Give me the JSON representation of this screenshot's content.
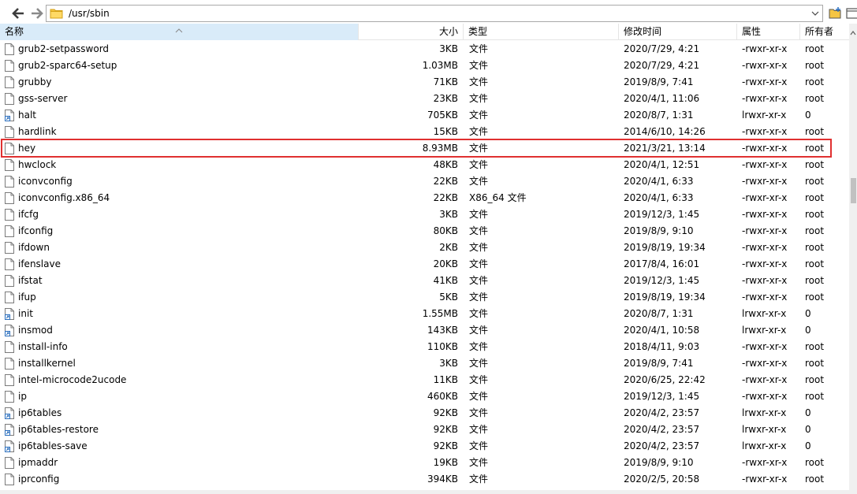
{
  "toolbar": {
    "back_icon": "arrow-left-icon",
    "forward_icon": "arrow-right-icon",
    "path": "/usr/sbin"
  },
  "columns": {
    "name": "名称",
    "size": "大小",
    "type": "类型",
    "mtime": "修改时间",
    "attr": "属性",
    "owner": "所有者"
  },
  "files": [
    {
      "name": "grub2-setpassword",
      "size": "3KB",
      "type": "文件",
      "mtime": "2020/7/29, 4:21",
      "attr": "-rwxr-xr-x",
      "owner": "root",
      "link": false
    },
    {
      "name": "grub2-sparc64-setup",
      "size": "1.03MB",
      "type": "文件",
      "mtime": "2020/7/29, 4:21",
      "attr": "-rwxr-xr-x",
      "owner": "root",
      "link": false
    },
    {
      "name": "grubby",
      "size": "71KB",
      "type": "文件",
      "mtime": "2019/8/9, 7:41",
      "attr": "-rwxr-xr-x",
      "owner": "root",
      "link": false
    },
    {
      "name": "gss-server",
      "size": "23KB",
      "type": "文件",
      "mtime": "2020/4/1, 11:06",
      "attr": "-rwxr-xr-x",
      "owner": "root",
      "link": false
    },
    {
      "name": "halt",
      "size": "705KB",
      "type": "文件",
      "mtime": "2020/8/7, 1:31",
      "attr": "lrwxr-xr-x",
      "owner": "0",
      "link": true
    },
    {
      "name": "hardlink",
      "size": "15KB",
      "type": "文件",
      "mtime": "2014/6/10, 14:26",
      "attr": "-rwxr-xr-x",
      "owner": "root",
      "link": false
    },
    {
      "name": "hey",
      "size": "8.93MB",
      "type": "文件",
      "mtime": "2021/3/21, 13:14",
      "attr": "-rwxr-xr-x",
      "owner": "root",
      "link": false
    },
    {
      "name": "hwclock",
      "size": "48KB",
      "type": "文件",
      "mtime": "2020/4/1, 12:51",
      "attr": "-rwxr-xr-x",
      "owner": "root",
      "link": false
    },
    {
      "name": "iconvconfig",
      "size": "22KB",
      "type": "文件",
      "mtime": "2020/4/1, 6:33",
      "attr": "-rwxr-xr-x",
      "owner": "root",
      "link": false
    },
    {
      "name": "iconvconfig.x86_64",
      "size": "22KB",
      "type": "X86_64 文件",
      "mtime": "2020/4/1, 6:33",
      "attr": "-rwxr-xr-x",
      "owner": "root",
      "link": false
    },
    {
      "name": "ifcfg",
      "size": "3KB",
      "type": "文件",
      "mtime": "2019/12/3, 1:45",
      "attr": "-rwxr-xr-x",
      "owner": "root",
      "link": false
    },
    {
      "name": "ifconfig",
      "size": "80KB",
      "type": "文件",
      "mtime": "2019/8/9, 9:10",
      "attr": "-rwxr-xr-x",
      "owner": "root",
      "link": false
    },
    {
      "name": "ifdown",
      "size": "2KB",
      "type": "文件",
      "mtime": "2019/8/19, 19:34",
      "attr": "-rwxr-xr-x",
      "owner": "root",
      "link": false
    },
    {
      "name": "ifenslave",
      "size": "20KB",
      "type": "文件",
      "mtime": "2017/8/4, 16:01",
      "attr": "-rwxr-xr-x",
      "owner": "root",
      "link": false
    },
    {
      "name": "ifstat",
      "size": "41KB",
      "type": "文件",
      "mtime": "2019/12/3, 1:45",
      "attr": "-rwxr-xr-x",
      "owner": "root",
      "link": false
    },
    {
      "name": "ifup",
      "size": "5KB",
      "type": "文件",
      "mtime": "2019/8/19, 19:34",
      "attr": "-rwxr-xr-x",
      "owner": "root",
      "link": false
    },
    {
      "name": "init",
      "size": "1.55MB",
      "type": "文件",
      "mtime": "2020/8/7, 1:31",
      "attr": "lrwxr-xr-x",
      "owner": "0",
      "link": true
    },
    {
      "name": "insmod",
      "size": "143KB",
      "type": "文件",
      "mtime": "2020/4/1, 10:58",
      "attr": "lrwxr-xr-x",
      "owner": "0",
      "link": true
    },
    {
      "name": "install-info",
      "size": "110KB",
      "type": "文件",
      "mtime": "2018/4/11, 9:03",
      "attr": "-rwxr-xr-x",
      "owner": "root",
      "link": false
    },
    {
      "name": "installkernel",
      "size": "3KB",
      "type": "文件",
      "mtime": "2019/8/9, 7:41",
      "attr": "-rwxr-xr-x",
      "owner": "root",
      "link": false
    },
    {
      "name": "intel-microcode2ucode",
      "size": "11KB",
      "type": "文件",
      "mtime": "2020/6/25, 22:42",
      "attr": "-rwxr-xr-x",
      "owner": "root",
      "link": false
    },
    {
      "name": "ip",
      "size": "460KB",
      "type": "文件",
      "mtime": "2019/12/3, 1:45",
      "attr": "-rwxr-xr-x",
      "owner": "root",
      "link": false
    },
    {
      "name": "ip6tables",
      "size": "92KB",
      "type": "文件",
      "mtime": "2020/4/2, 23:57",
      "attr": "lrwxr-xr-x",
      "owner": "0",
      "link": true
    },
    {
      "name": "ip6tables-restore",
      "size": "92KB",
      "type": "文件",
      "mtime": "2020/4/2, 23:57",
      "attr": "lrwxr-xr-x",
      "owner": "0",
      "link": true
    },
    {
      "name": "ip6tables-save",
      "size": "92KB",
      "type": "文件",
      "mtime": "2020/4/2, 23:57",
      "attr": "lrwxr-xr-x",
      "owner": "0",
      "link": true
    },
    {
      "name": "ipmaddr",
      "size": "19KB",
      "type": "文件",
      "mtime": "2019/8/9, 9:10",
      "attr": "-rwxr-xr-x",
      "owner": "root",
      "link": false
    },
    {
      "name": "iprconfig",
      "size": "394KB",
      "type": "文件",
      "mtime": "2020/2/5, 20:58",
      "attr": "-rwxr-xr-x",
      "owner": "root",
      "link": false
    }
  ],
  "highlighted_file": "hey",
  "colors": {
    "highlight_border": "#e03030",
    "sorted_header": "#d9ebf9",
    "folder_yellow": "#f5c542",
    "link_arrow": "#2a6ebd"
  }
}
